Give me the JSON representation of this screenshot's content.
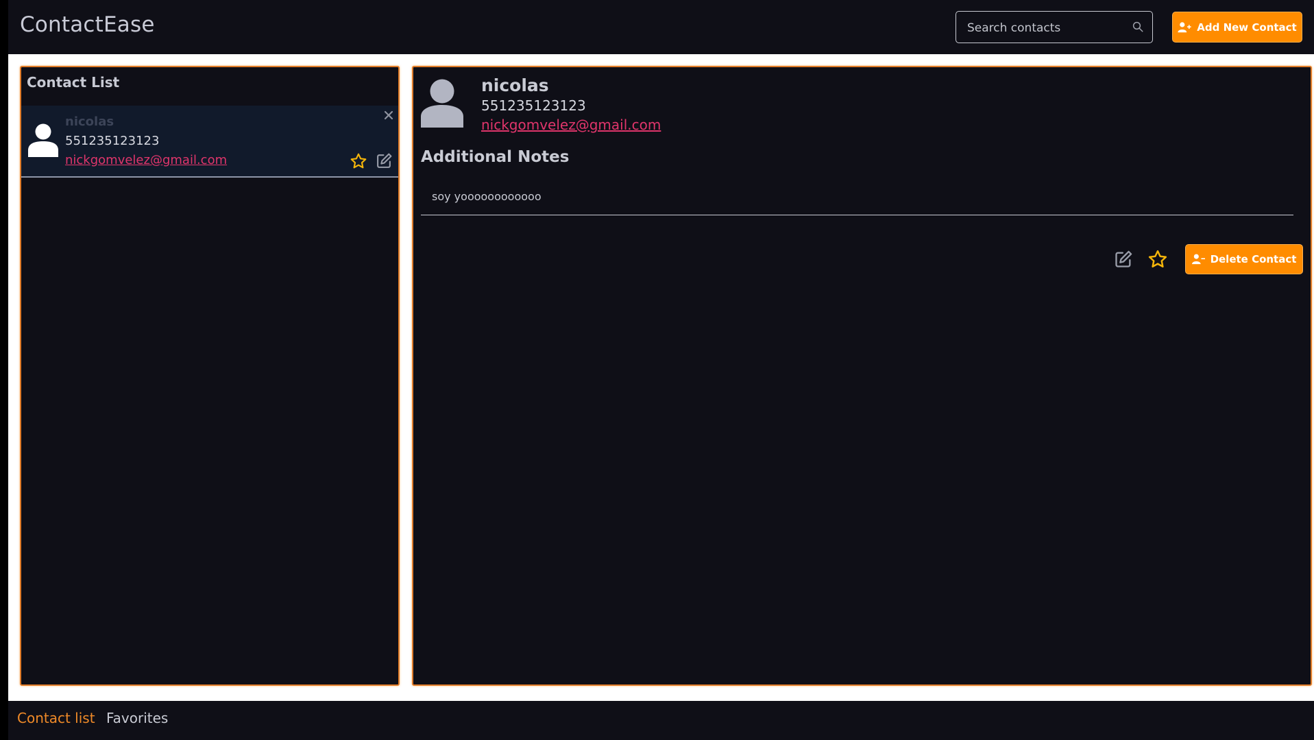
{
  "header": {
    "brand": "ContactEase",
    "search_placeholder": "Search contacts",
    "add_button_label": "Add New Contact"
  },
  "contact_list": {
    "title": "Contact List",
    "items": [
      {
        "name": "nicolas",
        "phone": "551235123123",
        "email": "nickgomvelez@gmail.com"
      }
    ]
  },
  "detail": {
    "name": "nicolas",
    "phone": "551235123123",
    "email": "nickgomvelez@gmail.com",
    "notes_title": "Additional Notes",
    "notes_text": "soy yoooooooooooo",
    "delete_button_label": "Delete Contact"
  },
  "footer": {
    "tabs": [
      "Contact list",
      "Favorites"
    ]
  },
  "colors": {
    "accent": "#ff8c00",
    "panel_bg": "#0f0f17",
    "email_link": "#e0356b",
    "star": "#f5b50a"
  }
}
